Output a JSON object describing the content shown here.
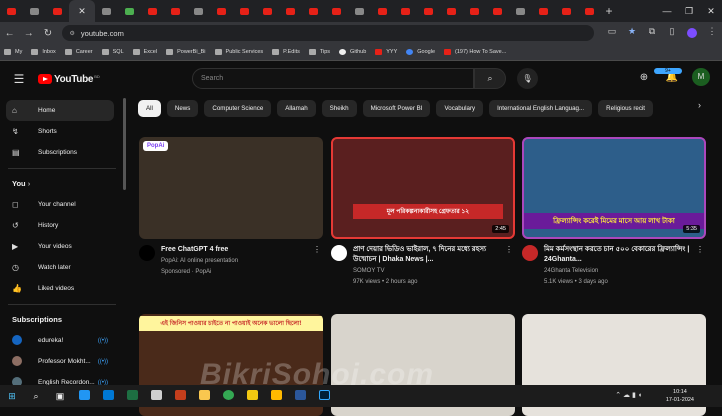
{
  "browser": {
    "tabs_count": 26,
    "url": "youtube.com",
    "bookmarks": [
      {
        "label": "My",
        "icon": "folder-icon"
      },
      {
        "label": "Inbox",
        "icon": "gmail-icon"
      },
      {
        "label": "Career",
        "icon": "folder-icon"
      },
      {
        "label": "SQL",
        "icon": "folder-icon"
      },
      {
        "label": "Excel",
        "icon": "folder-icon"
      },
      {
        "label": "PowerBi_Bi",
        "icon": "folder-icon"
      },
      {
        "label": "Public Services",
        "icon": "folder-icon"
      },
      {
        "label": "P.Edits",
        "icon": "folder-icon"
      },
      {
        "label": "Tips",
        "icon": "folder-icon"
      },
      {
        "label": "Github",
        "icon": "github-icon"
      },
      {
        "label": "YYY",
        "icon": "youtube-icon"
      },
      {
        "label": "Google",
        "icon": "google-icon"
      },
      {
        "label": "(197) How To Save...",
        "icon": "youtube-icon"
      }
    ]
  },
  "header": {
    "logo_text": "YouTube",
    "logo_suffix": "BD",
    "search_placeholder": "Search",
    "notification_count": "9+",
    "avatar_letter": "M"
  },
  "sidebar": {
    "main": [
      {
        "label": "Home",
        "icon": "home-icon",
        "active": true
      },
      {
        "label": "Shorts",
        "icon": "shorts-icon"
      },
      {
        "label": "Subscriptions",
        "icon": "subscriptions-icon"
      }
    ],
    "you_label": "You",
    "you_items": [
      {
        "label": "Your channel",
        "icon": "channel-icon"
      },
      {
        "label": "History",
        "icon": "history-icon"
      },
      {
        "label": "Your videos",
        "icon": "videos-icon"
      },
      {
        "label": "Watch later",
        "icon": "clock-icon"
      },
      {
        "label": "Liked videos",
        "icon": "like-icon"
      }
    ],
    "subscriptions_label": "Subscriptions",
    "subscriptions": [
      {
        "label": "edureka!",
        "color": "#1565c0"
      },
      {
        "label": "Professor Mokht...",
        "color": "#8d6e63"
      },
      {
        "label": "English Recordon...",
        "color": "#546e7a"
      }
    ]
  },
  "chips": [
    "All",
    "News",
    "Computer Science",
    "Allamah",
    "Sheikh",
    "Microsoft Power BI",
    "Vocabulary",
    "International English Languag...",
    "Religious recit"
  ],
  "videos": [
    {
      "title": "Free ChatGPT 4 free",
      "channel": "PopAi: AI online presentation",
      "stats": "Sponsored · PopAi",
      "duration": "",
      "thumb_color": "#3a3026",
      "avatar_color": "#000000",
      "thumb_caption": "PopAi"
    },
    {
      "title": "প্রাণ দেয়ার ভিডিও ভাইরাল, ৭ দিনের মধ্যে রহস্য উন্মোচন | Dhaka News |...",
      "channel": "SOMOY TV",
      "stats": "97K views • 2 hours ago",
      "duration": "2:45",
      "thumb_color": "#5a1f1f",
      "avatar_color": "#ffffff",
      "thumb_caption": "মূল পরিকল্পনাকারীসহ গ্রেফতার ১২"
    },
    {
      "title": "মিম কর্মসংস্থান করতে চান ৫০০ বেকারের ফ্রিল্যান্সিং | 24Ghanta...",
      "channel": "24Ghanta Television",
      "stats": "5.1K views • 3 days ago",
      "duration": "5:35",
      "thumb_color": "#2d5e8a",
      "avatar_color": "#c62828",
      "thumb_caption": "ফ্রিল্যান্সিং করেই মিমের মাসে আয় লাখ টাকা"
    },
    {
      "title": "",
      "channel": "",
      "stats": "",
      "duration": "",
      "thumb_color": "#4a2a1a",
      "avatar_color": "#333333",
      "thumb_caption": "এই জিনিস পাওয়ার চাইতে না পাওয়াই অনেক ভালো ছিলো!"
    },
    {
      "title": "",
      "channel": "",
      "stats": "",
      "duration": "",
      "thumb_color": "#d8d4cc",
      "avatar_color": "#333333",
      "thumb_caption": ""
    },
    {
      "title": "",
      "channel": "",
      "stats": "",
      "duration": "",
      "thumb_color": "#e6e2dc",
      "avatar_color": "#333333",
      "thumb_caption": ""
    }
  ],
  "taskbar": {
    "time": "10:14",
    "date": "17-01-2024"
  },
  "watermark": "BikriSohoj.com"
}
